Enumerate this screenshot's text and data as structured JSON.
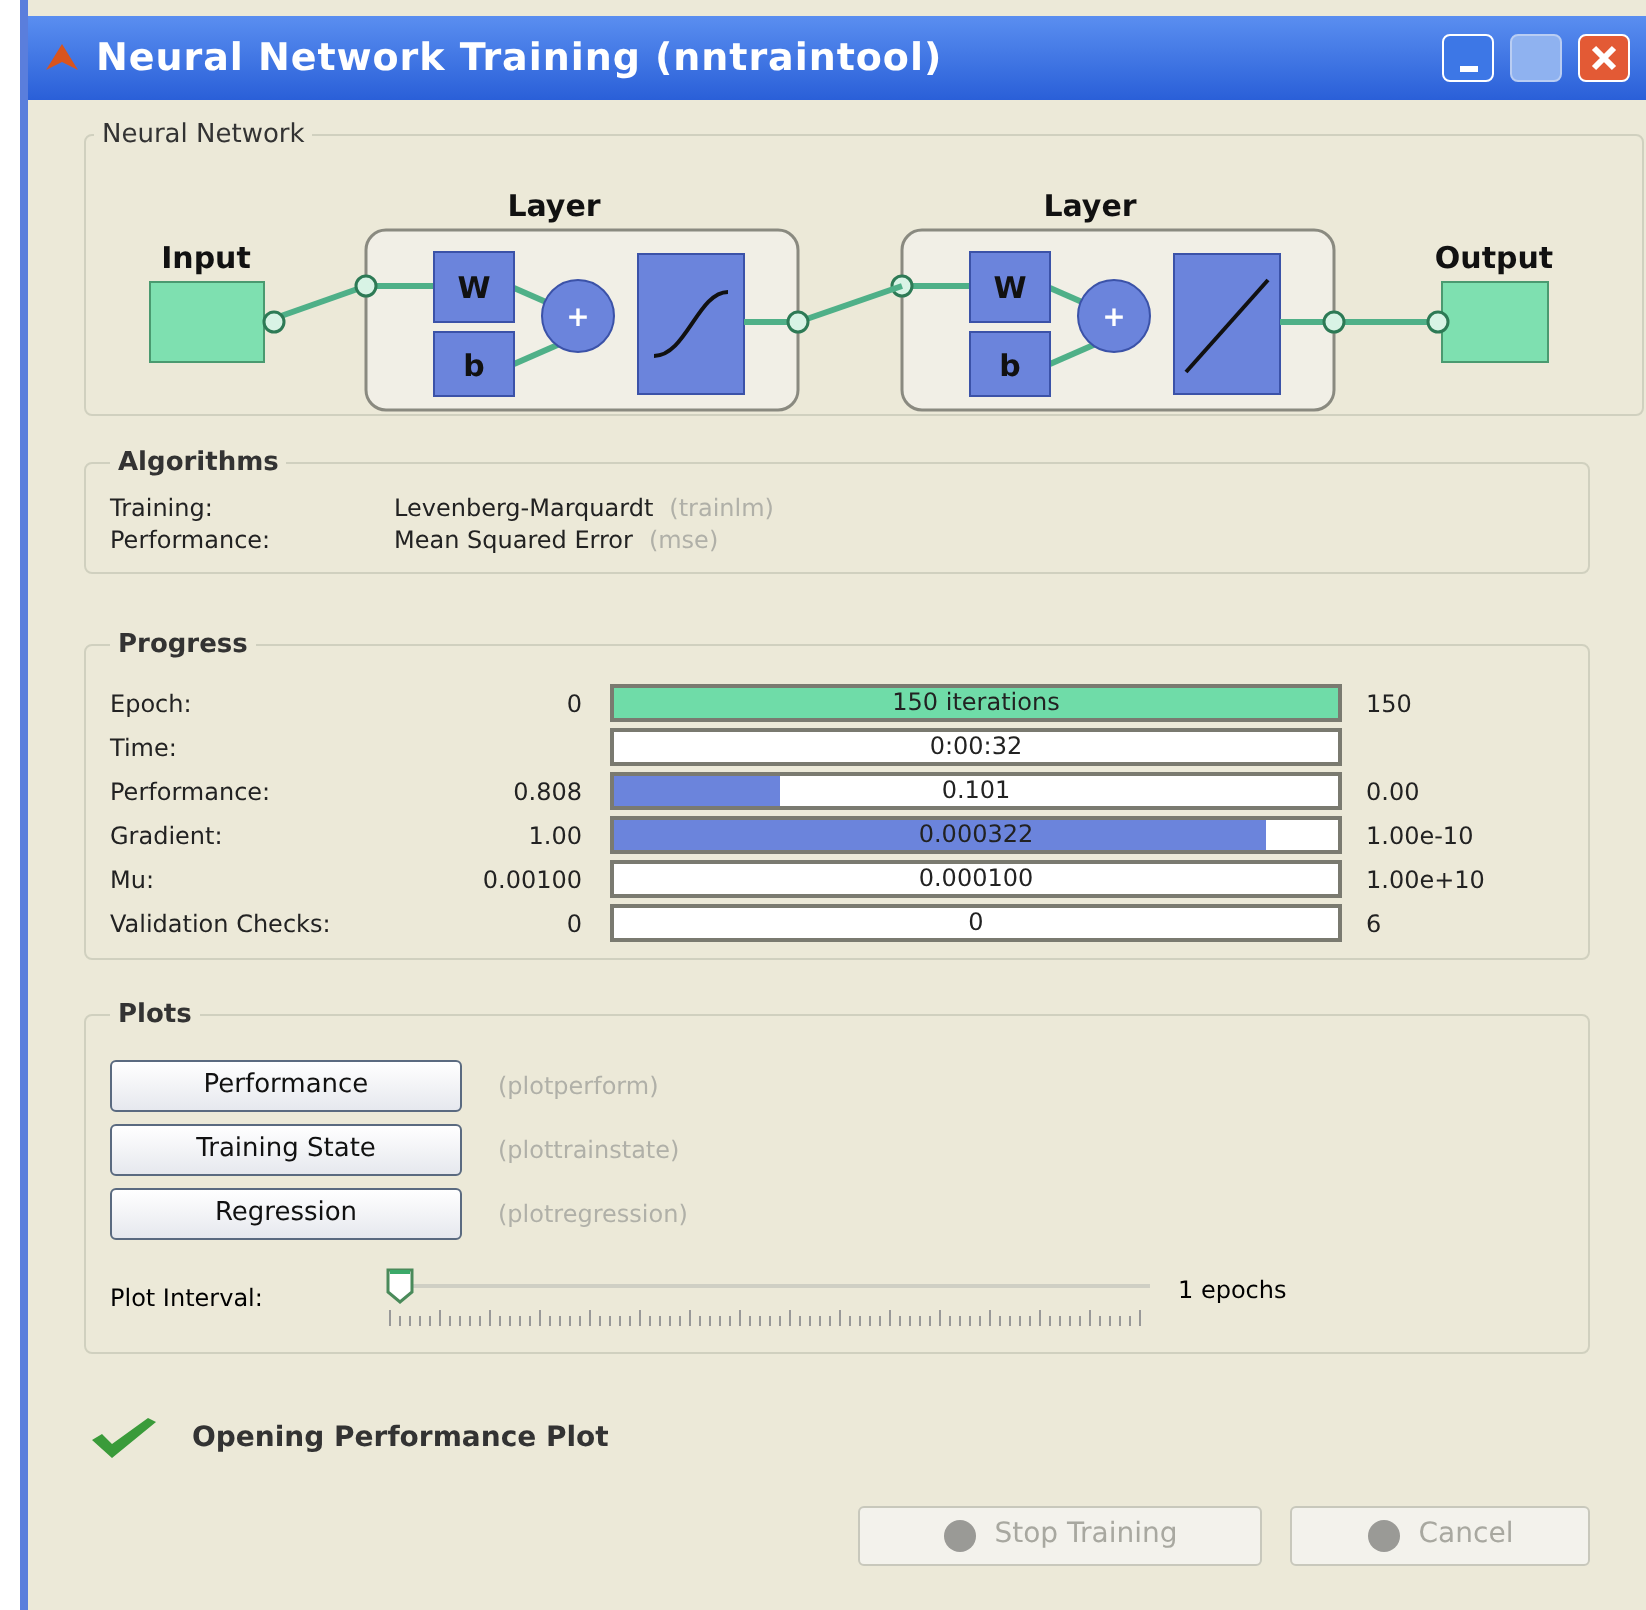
{
  "window": {
    "title": "Neural Network Training (nntraintool)"
  },
  "network": {
    "title": "Neural Network",
    "input_label": "Input",
    "output_label": "Output",
    "layers": [
      {
        "title": "Layer",
        "weight": "W",
        "bias": "b",
        "sum": "+",
        "kind": "sigmoid"
      },
      {
        "title": "Layer",
        "weight": "W",
        "bias": "b",
        "sum": "+",
        "kind": "linear"
      }
    ]
  },
  "algorithms": {
    "title": "Algorithms",
    "rows": [
      {
        "label": "Training:",
        "value": "Levenberg-Marquardt",
        "function": "(trainlm)"
      },
      {
        "label": "Performance:",
        "value": "Mean Squared Error",
        "function": "(mse)"
      }
    ]
  },
  "progress": {
    "title": "Progress",
    "rows": [
      {
        "label": "Epoch:",
        "start": "0",
        "bar": "150 iterations",
        "end": "150",
        "level": 1,
        "color": "#6fdca8"
      },
      {
        "label": "Time:",
        "bar": "0:00:32"
      },
      {
        "label": "Performance:",
        "start": "0.808",
        "bar": "0.101",
        "end": "0.00",
        "level": 0.23,
        "color": "#6b84dc"
      },
      {
        "label": "Gradient:",
        "start": "1.00",
        "bar": "0.000322",
        "end": "1.00e-10",
        "level": 0.9,
        "color": "#6b84dc"
      },
      {
        "label": "Mu:",
        "start": "0.00100",
        "bar": "0.000100",
        "end": "1.00e+10"
      },
      {
        "label": "Validation Checks:",
        "start": "0",
        "bar": "0",
        "end": "6"
      }
    ]
  },
  "plots": {
    "title": "Plots",
    "buttons": [
      {
        "label": "Performance",
        "function": "(plotperform)"
      },
      {
        "label": "Training State",
        "function": "(plottrainstate)"
      },
      {
        "label": "Regression",
        "function": "(plotregression)"
      }
    ],
    "interval": {
      "label": "Plot Interval:",
      "level": 0,
      "reading": "1 epochs"
    }
  },
  "status": {
    "text": "Opening Performance Plot"
  },
  "buttons": [
    {
      "label": "Stop Training",
      "disabled": true
    },
    {
      "label": "Cancel",
      "disabled": true
    }
  ]
}
